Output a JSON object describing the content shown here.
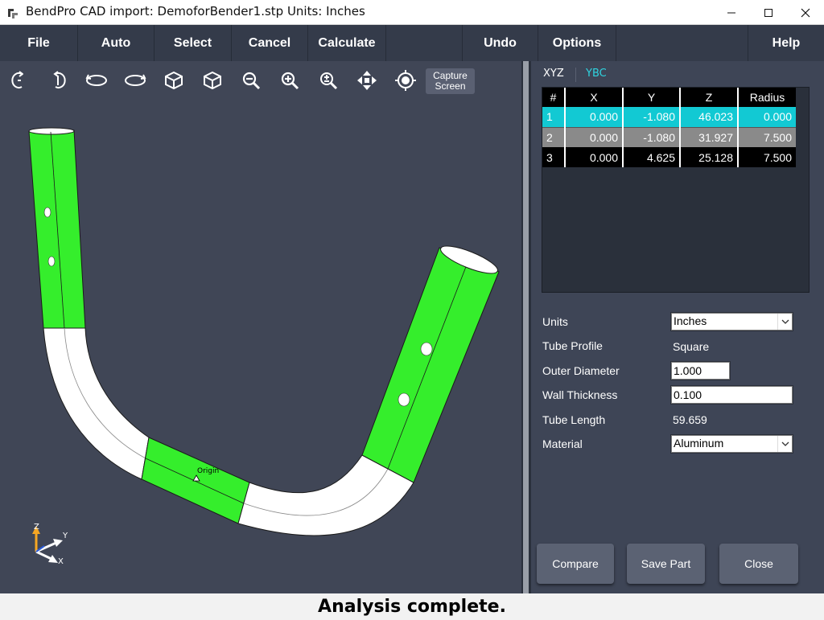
{
  "window": {
    "title": "BendPro CAD import: DemoforBender1.stp  Units: Inches"
  },
  "menu": {
    "file": "File",
    "auto": "Auto",
    "select": "Select",
    "cancel": "Cancel",
    "calculate": "Calculate",
    "undo": "Undo",
    "options": "Options",
    "help": "Help"
  },
  "toolbar": {
    "capture_line1": "Capture",
    "capture_line2": "Screen",
    "icons": [
      "rotate-x-icon",
      "rotate-y-icon",
      "rotate-ccw-icon",
      "rotate-cw-icon",
      "view-cube-icon",
      "view-cube-alt-icon",
      "zoom-out-icon",
      "zoom-in-icon",
      "zoom-fit-icon",
      "pan-icon",
      "center-target-icon"
    ]
  },
  "viewport": {
    "origin_label": "Origin",
    "axes": {
      "x": "X",
      "y": "Y",
      "z": "Z"
    },
    "colors": {
      "background": "#404656",
      "straight": "#35ee2c",
      "bend": "#ffffff"
    }
  },
  "tabs": {
    "xyz": "XYZ",
    "ybc": "YBC",
    "active": "XYZ",
    "ybc_color": "#2fd4e0"
  },
  "grid": {
    "headers": [
      "#",
      "X",
      "Y",
      "Z",
      "Radius"
    ],
    "rows": [
      [
        "1",
        "0.000",
        "-1.080",
        "46.023",
        "0.000"
      ],
      [
        "2",
        "0.000",
        "-1.080",
        "31.927",
        "7.500"
      ],
      [
        "3",
        "0.000",
        "4.625",
        "25.128",
        "7.500"
      ]
    ],
    "row_colors": [
      "#12c9d3",
      "#8a8a8a",
      "#000000"
    ]
  },
  "properties": {
    "units_label": "Units",
    "units_value": "Inches",
    "profile_label": "Tube Profile",
    "profile_value": "Square",
    "od_label": "Outer Diameter",
    "od_value": "1.000",
    "wall_label": "Wall Thickness",
    "wall_value": "0.100",
    "length_label": "Tube Length",
    "length_value": "59.659",
    "material_label": "Material",
    "material_value": "Aluminum"
  },
  "buttons": {
    "compare": "Compare",
    "save": "Save Part",
    "close": "Close"
  },
  "status": {
    "message": "Analysis complete."
  }
}
